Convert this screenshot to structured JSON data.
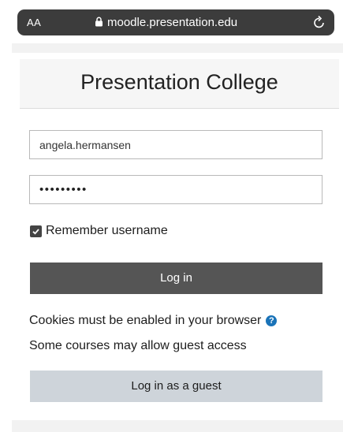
{
  "browser": {
    "text_size_label": "AA",
    "url": "moodle.presentation.edu",
    "icons": {
      "lock": "lock-icon",
      "reload": "reload-icon"
    }
  },
  "page": {
    "site_name": "Presentation College"
  },
  "login_form": {
    "username_value": "angela.hermansen",
    "password_mask": "•••••••••",
    "remember_checked": true,
    "remember_label": "Remember username",
    "login_button_label": "Log in"
  },
  "info": {
    "cookies_text": "Cookies must be enabled in your browser",
    "help_icon": "help-icon",
    "guest_access_text": "Some courses may allow guest access",
    "guest_button_label": "Log in as a guest"
  },
  "colors": {
    "login_button": "#555555",
    "guest_button": "#ced4da",
    "help_icon": "#1a73b8"
  }
}
